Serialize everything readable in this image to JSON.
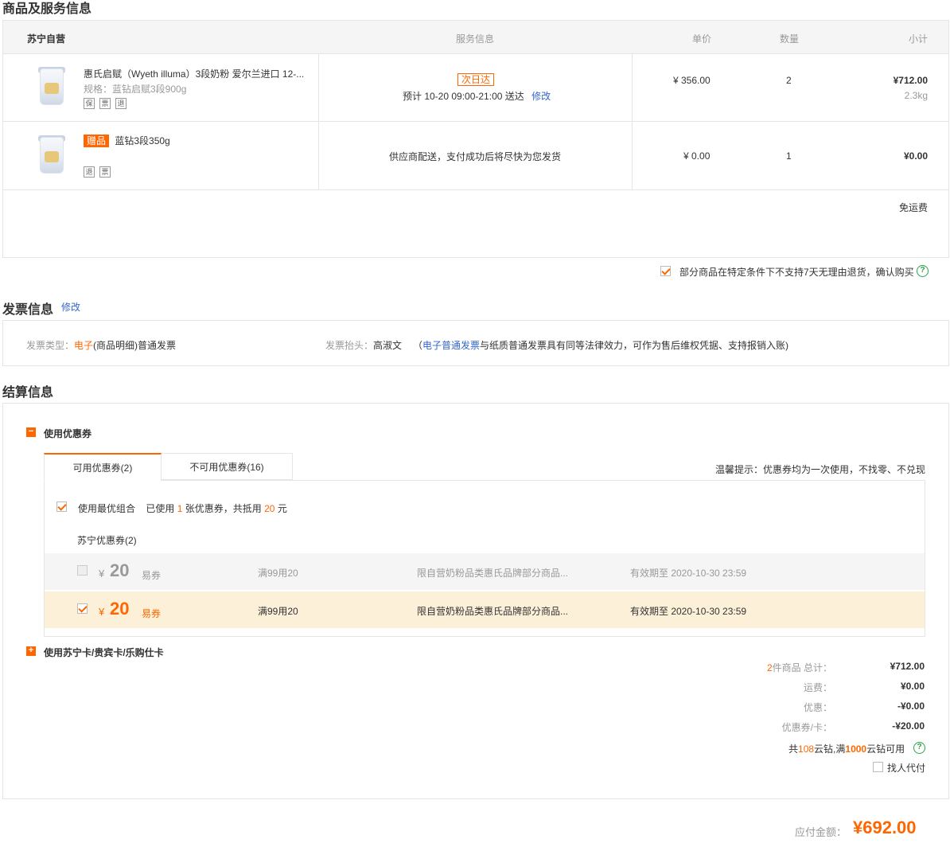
{
  "sections": {
    "products_title": "商品及服务信息",
    "invoice_title": "发票信息",
    "invoice_edit": "修改",
    "checkout_title": "结算信息"
  },
  "table_header": {
    "store": "苏宁自营",
    "service": "服务信息",
    "unit_price": "单价",
    "qty": "数量",
    "subtotal": "小计"
  },
  "items": [
    {
      "name": "惠氏启赋（Wyeth illuma）3段奶粉 爱尔兰进口 12-...",
      "spec": "规格：蓝钻启赋3段900g",
      "icons": [
        "price-protect-icon",
        "invoice-icon",
        "return-icon"
      ],
      "service_badge": "次日达",
      "service_text": "预计 10-20 09:00-21:00  送达",
      "service_edit": "修改",
      "price": "¥ 356.00",
      "qty": "2",
      "subtotal": "¥712.00",
      "weight": "2.3kg"
    },
    {
      "gift_badge": "赠品",
      "name": "蓝钻3段350g",
      "icons": [
        "return-icon",
        "invoice-icon"
      ],
      "service_text": "供应商配送，支付成功后将尽快为您发货",
      "price": "¥ 0.00",
      "qty": "1",
      "subtotal": "¥0.00"
    }
  ],
  "shipping_note": "免运费",
  "agree_text": "部分商品在特定条件下不支持7天无理由退货，确认购买",
  "invoice": {
    "type_label": "发票类型：",
    "type_em": "电子",
    "type_rest": "(商品明细)普通发票",
    "head_label": "发票抬头：",
    "head_value": "高淑文",
    "note_open": "（",
    "note_link": "电子普通发票",
    "note_rest": "与纸质普通发票具有同等法律效力，可作为售后维权凭据、支持报销入账)"
  },
  "coupon": {
    "section_label": "使用优惠券",
    "tab_available": "可用优惠券(2)",
    "tab_unavailable": "不可用优惠券(16)",
    "tip": "温馨提示：优惠券均为一次使用，不找零、不兑现",
    "best_combo": "使用最优组合",
    "used_pre": "已使用",
    "used_count": "1",
    "used_mid": "张优惠券，共抵用",
    "used_amount": "20",
    "used_unit": "元",
    "group_label": "苏宁优惠券(2)",
    "rows": [
      {
        "currency": "¥",
        "amount": "20",
        "kind": "易券",
        "condition": "满99用20",
        "scope": "限自营奶粉品类惠氏品牌部分商品...",
        "expiry": "有效期至 2020-10-30 23:59",
        "selected": false
      },
      {
        "currency": "¥",
        "amount": "20",
        "kind": "易券",
        "condition": "满99用20",
        "scope": "限自营奶粉品类惠氏品牌部分商品...",
        "expiry": "有效期至 2020-10-30 23:59",
        "selected": true
      }
    ]
  },
  "cards_label": "使用苏宁卡/贵宾卡/乐购仕卡",
  "summary": {
    "count": "2",
    "count_label": "件商品 总计：",
    "total": "¥712.00",
    "shipping_label": "运费：",
    "shipping": "¥0.00",
    "discount_label": "优惠：",
    "discount": "-¥0.00",
    "coupon_label": "优惠券/卡：",
    "coupon": "-¥20.00",
    "diamond_pre": "共",
    "diamond_count": "108",
    "diamond_mid": "云钻,满",
    "diamond_min": "1000",
    "diamond_post": "云钻可用",
    "proxy_pay": "找人代付",
    "payable_label": "应付金额：",
    "payable": "¥692.00"
  },
  "colors": {
    "accent": "#ff6600",
    "link": "#3366cc",
    "help": "#2aa34a",
    "coupon_selected_bg": "#fcf1d8"
  }
}
